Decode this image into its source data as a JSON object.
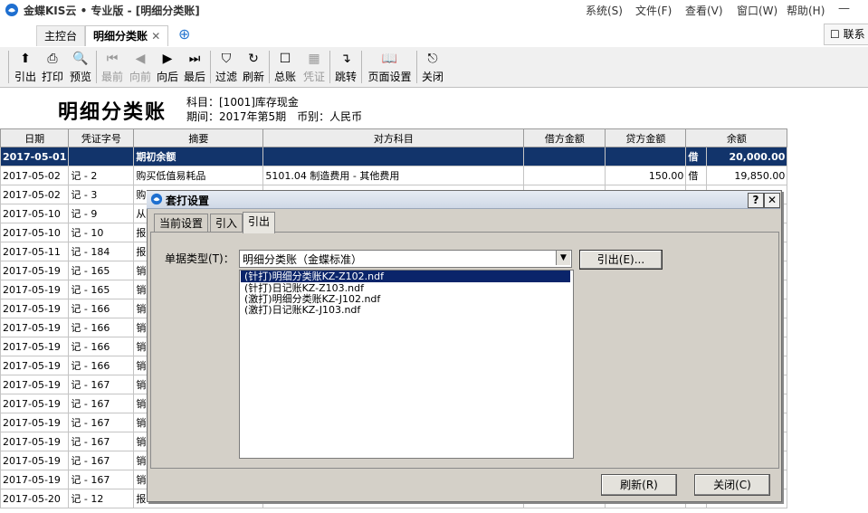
{
  "app": {
    "title": "金蝶KIS云 • 专业版 - [明细分类账]",
    "menus": [
      "系统(S)",
      "文件(F)",
      "查看(V)",
      "窗口(W)",
      "帮助(H)"
    ]
  },
  "tabs": {
    "home": "主控台",
    "ledger": "明细分类账",
    "contact": "联系"
  },
  "toolbar": {
    "items": [
      {
        "label": "引出",
        "icon": "export-icon"
      },
      {
        "label": "打印",
        "icon": "print-icon"
      },
      {
        "label": "预览",
        "icon": "preview-icon"
      },
      {
        "label": "最前",
        "icon": "first-icon",
        "disabled": true
      },
      {
        "label": "向前",
        "icon": "prev-icon",
        "disabled": true
      },
      {
        "label": "向后",
        "icon": "next-icon"
      },
      {
        "label": "最后",
        "icon": "last-icon"
      },
      {
        "label": "过滤",
        "icon": "filter-icon"
      },
      {
        "label": "刷新",
        "icon": "refresh-icon"
      },
      {
        "label": "总账",
        "icon": "general-ledger-icon"
      },
      {
        "label": "凭证",
        "icon": "voucher-icon",
        "disabled": true
      },
      {
        "label": "跳转",
        "icon": "jump-icon"
      },
      {
        "label": "页面设置",
        "icon": "page-setup-icon"
      },
      {
        "label": "关闭",
        "icon": "close-door-icon"
      }
    ]
  },
  "report": {
    "title": "明细分类账",
    "subject": "科目：[1001]库存现金",
    "period": "期间：2017年第5期　币别：人民币"
  },
  "table": {
    "headers": [
      "日期",
      "凭证字号",
      "摘要",
      "对方科目",
      "借方金额",
      "贷方金额",
      "余额"
    ],
    "opening": {
      "date": "2017-05-01",
      "summary": "期初余额",
      "direction": "借",
      "balance": "20,000.00"
    },
    "rows": [
      {
        "date": "2017-05-02",
        "voucher": "记 - 2",
        "summary": "购买低值易耗品",
        "contra": "5101.04 制造费用 - 其他费用",
        "debit": "",
        "credit": "150.00",
        "dir": "借",
        "balance": "19,850.00"
      },
      {
        "date": "2017-05-02",
        "voucher": "记 - 3",
        "summary": "购",
        "contra": "",
        "debit": "",
        "credit": "",
        "dir": "",
        "balance": ""
      },
      {
        "date": "2017-05-10",
        "voucher": "记 - 9",
        "summary": "从",
        "contra": "",
        "debit": "",
        "credit": "",
        "dir": "",
        "balance": ""
      },
      {
        "date": "2017-05-10",
        "voucher": "记 - 10",
        "summary": "报",
        "contra": "",
        "debit": "",
        "credit": "",
        "dir": "",
        "balance": ""
      },
      {
        "date": "2017-05-11",
        "voucher": "记 - 184",
        "summary": "报",
        "contra": "",
        "debit": "",
        "credit": "",
        "dir": "",
        "balance": ""
      },
      {
        "date": "2017-05-19",
        "voucher": "记 - 165",
        "summary": "销",
        "contra": "",
        "debit": "",
        "credit": "",
        "dir": "",
        "balance": ""
      },
      {
        "date": "2017-05-19",
        "voucher": "记 - 165",
        "summary": "销",
        "contra": "",
        "debit": "",
        "credit": "",
        "dir": "",
        "balance": ""
      },
      {
        "date": "2017-05-19",
        "voucher": "记 - 166",
        "summary": "销",
        "contra": "",
        "debit": "",
        "credit": "",
        "dir": "",
        "balance": ""
      },
      {
        "date": "2017-05-19",
        "voucher": "记 - 166",
        "summary": "销",
        "contra": "",
        "debit": "",
        "credit": "",
        "dir": "",
        "balance": ""
      },
      {
        "date": "2017-05-19",
        "voucher": "记 - 166",
        "summary": "销",
        "contra": "",
        "debit": "",
        "credit": "",
        "dir": "",
        "balance": ""
      },
      {
        "date": "2017-05-19",
        "voucher": "记 - 166",
        "summary": "销",
        "contra": "",
        "debit": "",
        "credit": "",
        "dir": "",
        "balance": ""
      },
      {
        "date": "2017-05-19",
        "voucher": "记 - 167",
        "summary": "销",
        "contra": "",
        "debit": "",
        "credit": "",
        "dir": "",
        "balance": ""
      },
      {
        "date": "2017-05-19",
        "voucher": "记 - 167",
        "summary": "销",
        "contra": "",
        "debit": "",
        "credit": "",
        "dir": "",
        "balance": ""
      },
      {
        "date": "2017-05-19",
        "voucher": "记 - 167",
        "summary": "销",
        "contra": "",
        "debit": "",
        "credit": "",
        "dir": "",
        "balance": ""
      },
      {
        "date": "2017-05-19",
        "voucher": "记 - 167",
        "summary": "销",
        "contra": "",
        "debit": "",
        "credit": "",
        "dir": "",
        "balance": ""
      },
      {
        "date": "2017-05-19",
        "voucher": "记 - 167",
        "summary": "销",
        "contra": "",
        "debit": "",
        "credit": "",
        "dir": "",
        "balance": ""
      },
      {
        "date": "2017-05-19",
        "voucher": "记 - 167",
        "summary": "销",
        "contra": "",
        "debit": "",
        "credit": "",
        "dir": "",
        "balance": ""
      },
      {
        "date": "2017-05-20",
        "voucher": "记 - 12",
        "summary": "报",
        "contra": "",
        "debit": "",
        "credit": "",
        "dir": "",
        "balance": ""
      }
    ]
  },
  "dialog": {
    "title": "套打设置",
    "tabs": [
      "当前设置",
      "引入",
      "引出"
    ],
    "doctype_label": "单据类型(T)：",
    "doctype_value": "明细分类账（金蝶标准）",
    "export_button": "引出(E)...",
    "files": [
      "(针打)明细分类账KZ-Z102.ndf",
      "(针打)日记账KZ-Z103.ndf",
      "(激打)明细分类账KZ-J102.ndf",
      "(激打)日记账KZ-J103.ndf"
    ],
    "refresh_button": "刷新(R)",
    "close_button": "关闭(C)",
    "help_label": "?",
    "close_x": "✕"
  },
  "colors": {
    "selection": "#0a246a",
    "opening_row": "#12346b",
    "dialog_bg": "#d4d0c8"
  }
}
